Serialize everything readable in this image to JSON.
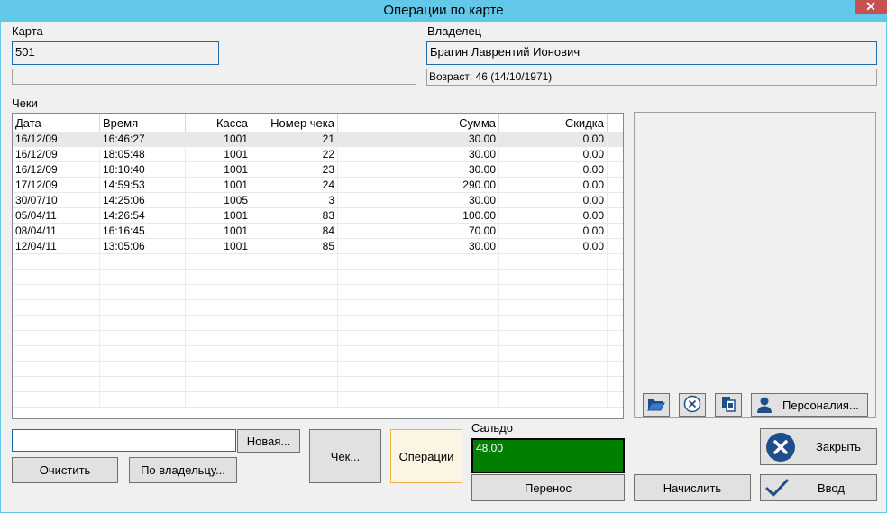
{
  "window": {
    "title": "Операции по карте",
    "close_glyph": "✕"
  },
  "card": {
    "label": "Карта",
    "value": "501"
  },
  "owner": {
    "label": "Владелец",
    "name": "Брагин Лаврентий Ионович",
    "age": "Возраст: 46 (14/10/1971)"
  },
  "checks": {
    "label": "Чеки",
    "columns": [
      "Дата",
      "Время",
      "Касса",
      "Номер чека",
      "Сумма",
      "Скидка"
    ],
    "rows": [
      [
        "16/12/09",
        "16:46:27",
        "1001",
        "21",
        "30.00",
        "0.00"
      ],
      [
        "16/12/09",
        "18:05:48",
        "1001",
        "22",
        "30.00",
        "0.00"
      ],
      [
        "16/12/09",
        "18:10:40",
        "1001",
        "23",
        "30.00",
        "0.00"
      ],
      [
        "17/12/09",
        "14:59:53",
        "1001",
        "24",
        "290.00",
        "0.00"
      ],
      [
        "30/07/10",
        "14:25:06",
        "1005",
        "3",
        "30.00",
        "0.00"
      ],
      [
        "05/04/11",
        "14:26:54",
        "1001",
        "83",
        "100.00",
        "0.00"
      ],
      [
        "08/04/11",
        "16:16:45",
        "1001",
        "84",
        "70.00",
        "0.00"
      ],
      [
        "12/04/11",
        "13:05:06",
        "1001",
        "85",
        "30.00",
        "0.00"
      ]
    ]
  },
  "panel": {
    "icons": [
      "folder-open-icon",
      "cancel-circle-icon",
      "copy-icon",
      "person-icon"
    ],
    "personal_label": "Персоналия..."
  },
  "bottom": {
    "search_value": "",
    "new_label": "Новая...",
    "clear_label": "Очистить",
    "by_owner_label": "По владельцу...",
    "check_label": "Чек...",
    "operations_label": "Операции",
    "saldo_label": "Сальдо",
    "saldo_value": "48.00",
    "transfer_label": "Перенос",
    "accrue_label": "Начислить",
    "close_label": "Закрыть",
    "enter_label": "Ввод"
  },
  "colors": {
    "titlebar": "#62c8e9",
    "saldo_bg": "#007e00",
    "close_icon": "#1f4e8c"
  }
}
